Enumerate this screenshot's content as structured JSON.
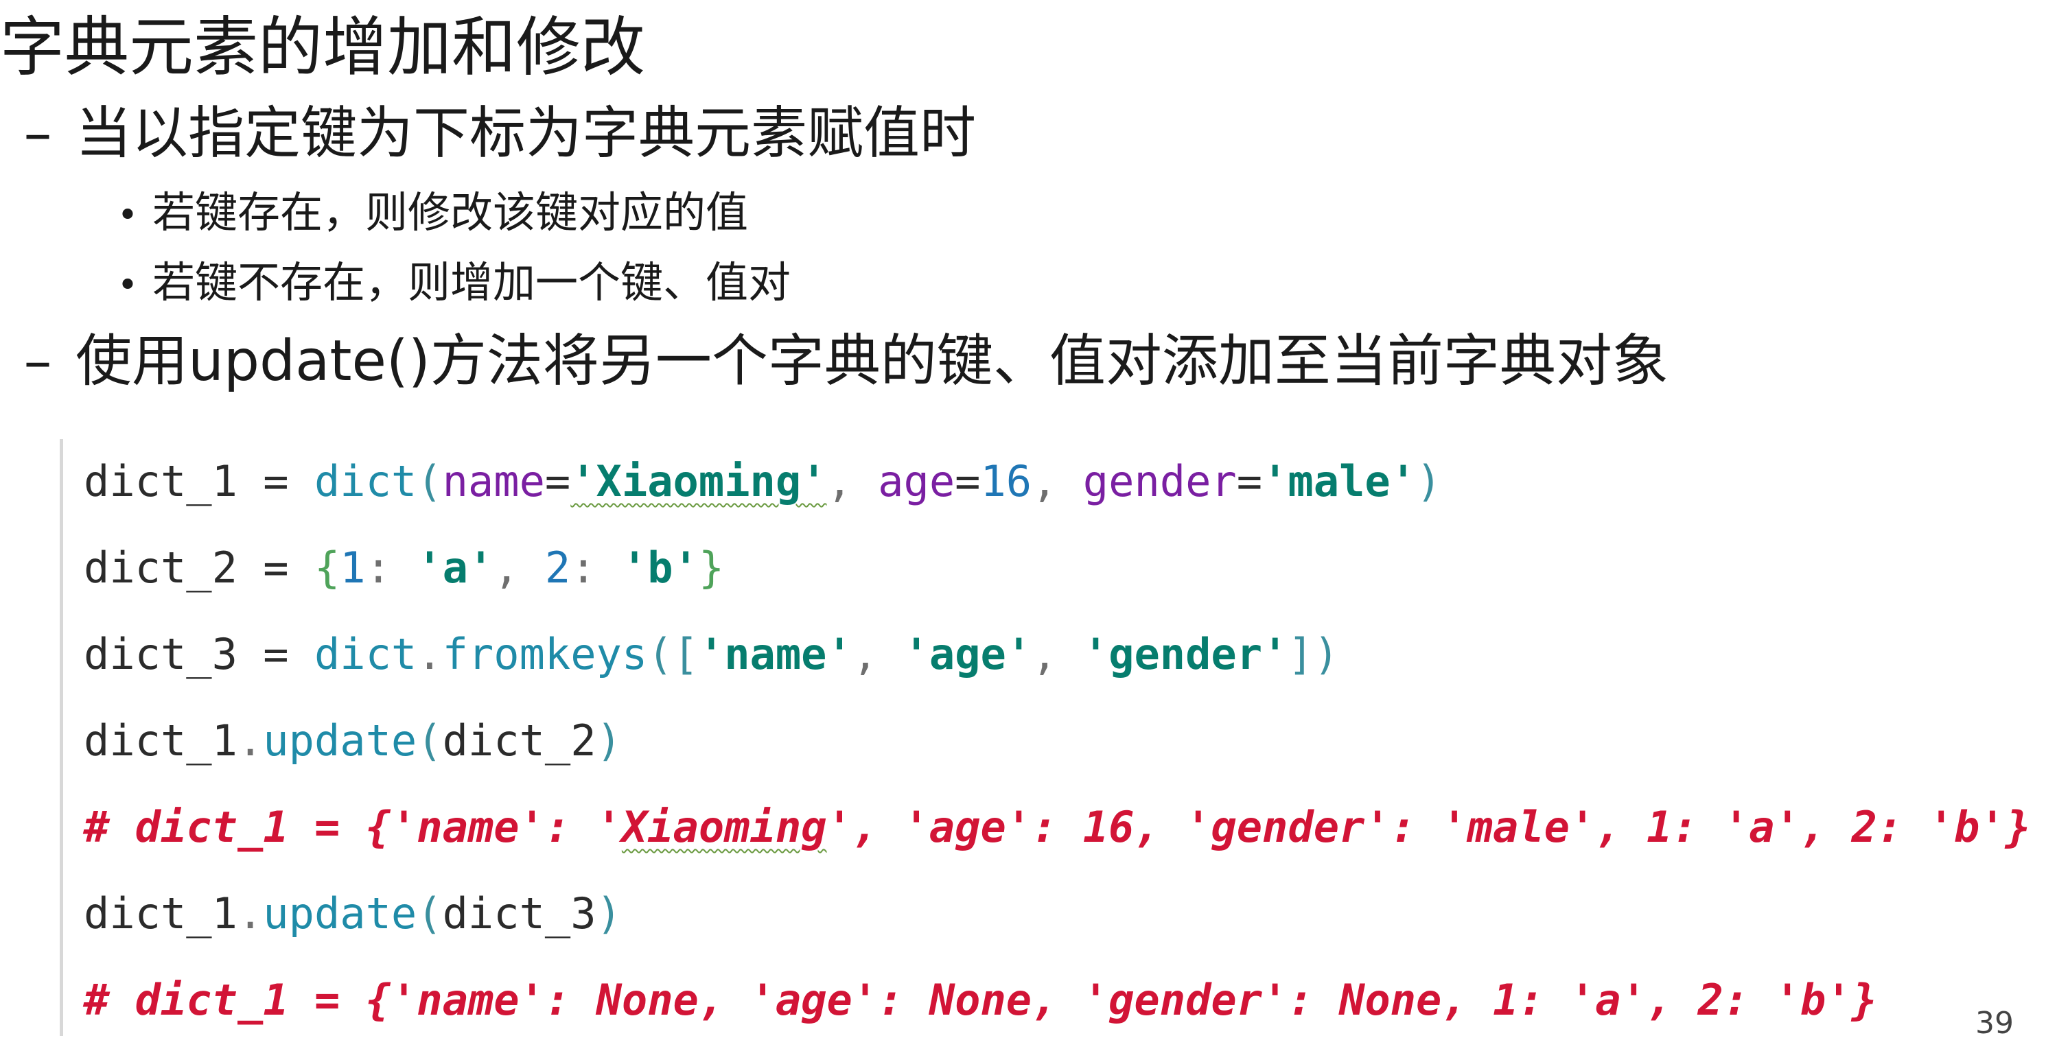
{
  "title": "字典元素的增加和修改",
  "bullets": [
    {
      "marker": "–",
      "text": "当以指定键为下标为字典元素赋值时"
    },
    {
      "marker": "•",
      "text": "若键存在，则修改该键对应的值"
    },
    {
      "marker": "•",
      "text": "若键不存在，则增加一个键、值对"
    },
    {
      "marker": "–",
      "text": "使用update()方法将另一个字典的键、值对添加至当前字典对象"
    }
  ],
  "code": {
    "line1": {
      "var": "dict_1",
      "eq": " = ",
      "func": "dict",
      "lp": "(",
      "k1": "name",
      "e1": "=",
      "s1": "'Xiaoming'",
      "c1": ", ",
      "k2": "age",
      "e2": "=",
      "n1": "16",
      "c2": ", ",
      "k3": "gender",
      "e3": "=",
      "s2": "'male'",
      "rp": ")"
    },
    "line2": {
      "var": "dict_2",
      "eq": " = ",
      "lb": "{",
      "n1": "1",
      "col1": ": ",
      "s1": "'a'",
      "c1": ", ",
      "n2": "2",
      "col2": ": ",
      "s2": "'b'",
      "rb": "}"
    },
    "line3": {
      "var": "dict_3",
      "eq": " = ",
      "func": "dict",
      "dot": ".",
      "method": "fromkeys",
      "lp": "(",
      "lsq": "[",
      "s1": "'name'",
      "c1": ", ",
      "s2": "'age'",
      "c2": ", ",
      "s3": "'gender'",
      "rsq": "]",
      "rp": ")"
    },
    "line4": {
      "var": "dict_1",
      "dot": ".",
      "method": "update",
      "lp": "(",
      "arg": "dict_2",
      "rp": ")"
    },
    "comment1_a": "# dict_1 = {'name': '",
    "comment1_squig": "Xiaoming",
    "comment1_b": "', 'age': 16, 'gender': 'male', 1: 'a', 2: 'b'}",
    "line6": {
      "var": "dict_1",
      "dot": ".",
      "method": "update",
      "lp": "(",
      "arg": "dict_3",
      "rp": ")"
    },
    "comment2": "# dict_1 = {'name': None, 'age': None, 'gender': None, 1: 'a', 2: 'b'}"
  },
  "page_number": "39"
}
